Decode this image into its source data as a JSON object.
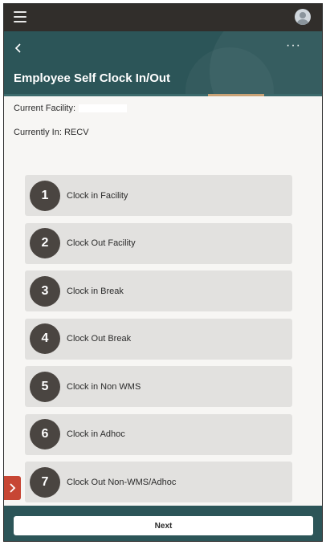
{
  "app": {
    "title": "Employee Self Clock In/Out",
    "more_glyph": "···"
  },
  "info": {
    "facility_label": "Current Facility:",
    "currently_in": "Currently In: RECV"
  },
  "menu": {
    "items": [
      {
        "num": "1",
        "label": "Clock in Facility"
      },
      {
        "num": "2",
        "label": "Clock Out Facility"
      },
      {
        "num": "3",
        "label": "Clock in Break"
      },
      {
        "num": "4",
        "label": "Clock Out Break"
      },
      {
        "num": "5",
        "label": "Clock in Non WMS"
      },
      {
        "num": "6",
        "label": "Clock in Adhoc"
      },
      {
        "num": "7",
        "label": "Clock Out Non-WMS/Adhoc"
      }
    ]
  },
  "footer": {
    "next_label": "Next"
  },
  "colors": {
    "topbar": "#312e2b",
    "header": "#2c5558",
    "menu_item": "#e2e1df",
    "number_circle": "#4a4541",
    "side_tab": "#c74634"
  },
  "icons": {
    "menu": "hamburger-icon",
    "avatar": "user-avatar-icon",
    "back": "chevron-left-icon",
    "more": "more-horizontal-icon",
    "side_tab": "chevron-right-icon"
  }
}
